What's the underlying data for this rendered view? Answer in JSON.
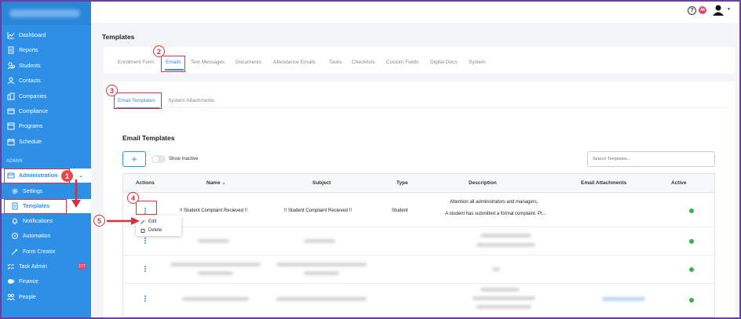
{
  "sidebar": {
    "items": [
      {
        "label": "Dashboard",
        "icon": "chart-line-icon"
      },
      {
        "label": "Reports",
        "icon": "report-icon"
      },
      {
        "label": "Students",
        "icon": "students-icon"
      },
      {
        "label": "Contacts",
        "icon": "contacts-icon"
      },
      {
        "label": "Companies",
        "icon": "building-icon"
      },
      {
        "label": "Compliance",
        "icon": "compliance-icon"
      },
      {
        "label": "Programs",
        "icon": "programs-icon"
      },
      {
        "label": "Schedule",
        "icon": "calendar-icon"
      }
    ],
    "admin_label": "ADMIN",
    "admin_items": [
      {
        "label": "Administration",
        "icon": "admin-icon"
      },
      {
        "label": "Settings",
        "icon": "gear-icon"
      },
      {
        "label": "Templates",
        "icon": "document-icon"
      },
      {
        "label": "Notifications",
        "icon": "bell-icon"
      },
      {
        "label": "Automation",
        "icon": "automation-icon"
      },
      {
        "label": "Form Creator",
        "icon": "magic-wand-icon"
      },
      {
        "label": "Task Admin",
        "icon": "tasks-icon",
        "badge": "177"
      },
      {
        "label": "Finance",
        "icon": "finance-icon"
      },
      {
        "label": "People",
        "icon": "people-icon"
      }
    ]
  },
  "topbar": {
    "help": "?",
    "notifications_count": "44"
  },
  "page": {
    "title": "Templates",
    "tabs": [
      "Enrolment Form",
      "Emails",
      "Text Messages",
      "Documents",
      "Attendance Emails",
      "Tasks",
      "Checklists",
      "Custom Fields",
      "Digital Docs",
      "System"
    ],
    "active_tab": "Emails",
    "subtabs": [
      "Email Templates",
      "System Attachments"
    ],
    "section_title": "Email Templates",
    "add_button": "+",
    "show_inactive": "Show Inactive",
    "search_placeholder": "Search Templates..."
  },
  "table": {
    "headers": [
      "Actions",
      "Name",
      "Subject",
      "Type",
      "Description",
      "Email Attachments",
      "Active"
    ],
    "sort_indicator": "▲",
    "first_row": {
      "name": "!! Student Complaint Recieved !!",
      "subject": "!! Student Complaint Recieved !!",
      "type": "Student",
      "description_line1": "Attention all administrators and managers,",
      "description_line2": "A student has submitted a formal complaint. Pl..."
    }
  },
  "actions_menu": {
    "edit": "Edit",
    "delete": "Delete"
  },
  "callouts": [
    "1",
    "2",
    "3",
    "4",
    "5"
  ],
  "colors": {
    "sidebar": "#2d8fe6",
    "accent": "#2d8fe6",
    "callout": "#d9303e",
    "active_check": "#37b24d"
  }
}
